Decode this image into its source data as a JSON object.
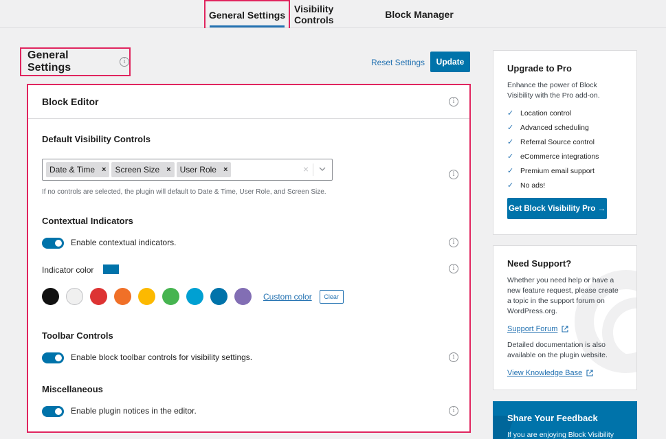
{
  "nav": {
    "tabs": [
      {
        "label": "General Settings",
        "active": true
      },
      {
        "label": "Visibility Controls",
        "active": false
      },
      {
        "label": "Block Manager",
        "active": false
      }
    ]
  },
  "header": {
    "title": "General Settings",
    "reset_label": "Reset Settings",
    "update_label": "Update"
  },
  "block_editor": {
    "title": "Block Editor",
    "default_controls": {
      "title": "Default Visibility Controls",
      "selected": [
        "Date & Time",
        "Screen Size",
        "User Role"
      ],
      "remove_glyph": "×",
      "clear_glyph": "×",
      "help": "If no controls are selected, the plugin will default to Date & Time, User Role, and Screen Size."
    },
    "contextual": {
      "title": "Contextual Indicators",
      "toggle_label": "Enable contextual indicators.",
      "toggle_on": true,
      "indicator_label": "Indicator color",
      "indicator_color": "#0073aa",
      "palette": [
        "#111111",
        "#f0f0f0",
        "#dd3333",
        "#f07028",
        "#fcb900",
        "#46b450",
        "#00a0d2",
        "#0073aa",
        "#826eb4"
      ],
      "custom_color_label": "Custom color",
      "clear_label": "Clear"
    },
    "toolbar": {
      "title": "Toolbar Controls",
      "toggle_label": "Enable block toolbar controls for visibility settings.",
      "toggle_on": true
    },
    "misc": {
      "title": "Miscellaneous",
      "toggle_label": "Enable plugin notices in the editor.",
      "toggle_on": true
    }
  },
  "sidebar": {
    "upgrade": {
      "title": "Upgrade to Pro",
      "text": "Enhance the power of Block Visibility with the Pro add-on.",
      "features": [
        "Location control",
        "Advanced scheduling",
        "Referral Source control",
        "eCommerce integrations",
        "Premium email support",
        "No ads!"
      ],
      "button": "Get Block Visibility Pro →"
    },
    "support": {
      "title": "Need Support?",
      "text": "Whether you need help or have a new feature request, please create a topic in the support forum on WordPress.org.",
      "forum_link": "Support Forum",
      "docs_text": "Detailed documentation is also available on the plugin website.",
      "kb_link": "View Knowledge Base"
    },
    "feedback": {
      "title": "Share Your Feedback",
      "text": "If you are enjoying Block Visibility"
    }
  },
  "icons": {
    "info": "i",
    "check": "✓"
  },
  "colors": {
    "accent": "#0073aa",
    "highlight": "#e0245e",
    "link": "#2271b1"
  }
}
